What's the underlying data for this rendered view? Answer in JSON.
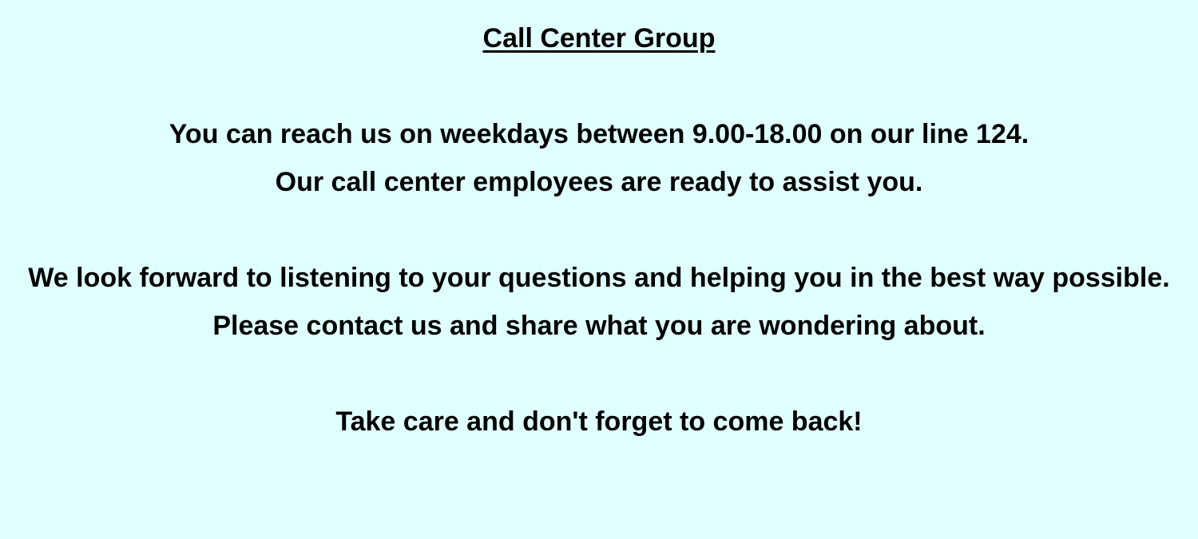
{
  "page": {
    "title": "Call Center Group",
    "paragraphs": [
      "You can reach us on weekdays between 9.00-18.00 on our line 124.",
      "Our call center employees are ready to assist you.",
      "We look forward to listening to your questions and helping you in the best way possible.",
      "Please contact us and share what you are wondering about.",
      "Take care and don't forget to come back!"
    ]
  },
  "colors": {
    "background": "#e0ffff",
    "text": "#000000"
  }
}
